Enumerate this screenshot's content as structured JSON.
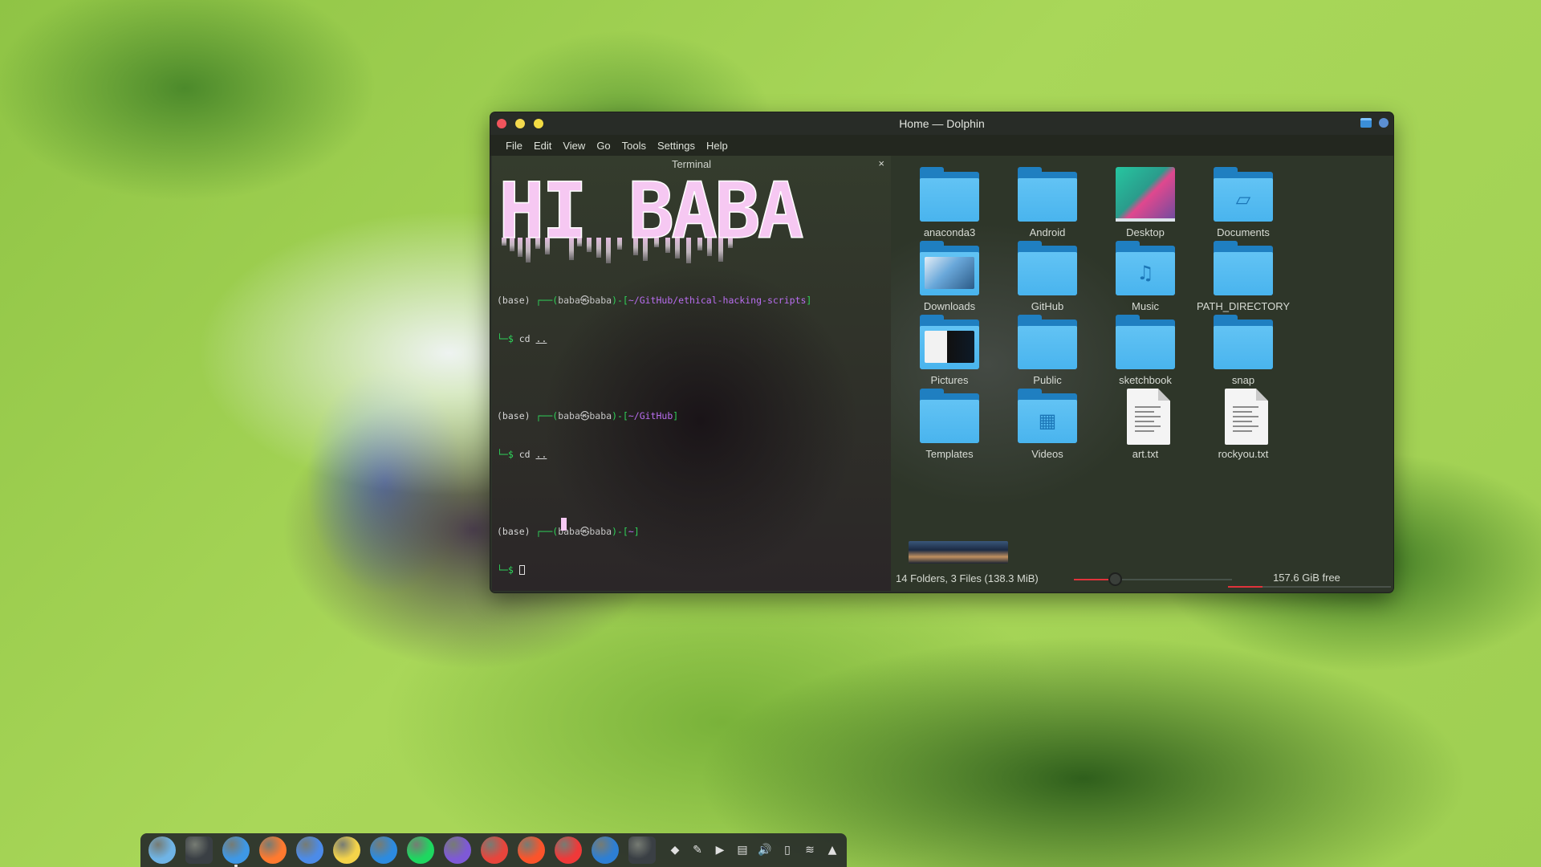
{
  "window": {
    "title": "Home — Dolphin",
    "menu": [
      "File",
      "Edit",
      "View",
      "Go",
      "Tools",
      "Settings",
      "Help"
    ]
  },
  "terminal": {
    "title": "Terminal",
    "close_glyph": "×",
    "banner": "HI BABA",
    "lines": [
      {
        "env": "(base)",
        "prefix": "┌──(",
        "user": "baba㉿baba",
        "mid": ")-[",
        "path": "~/GitHub/ethical-hacking-scripts",
        "end": "]",
        "cmd_prefix": "└─$",
        "cmd": "cd",
        "arg": ".."
      },
      {
        "env": "(base)",
        "prefix": "┌──(",
        "user": "baba㉿baba",
        "mid": ")-[",
        "path": "~/GitHub",
        "end": "]",
        "cmd_prefix": "└─$",
        "cmd": "cd",
        "arg": ".."
      },
      {
        "env": "(base)",
        "prefix": "┌──(",
        "user": "baba㉿baba",
        "mid": ")-[",
        "path": "~",
        "end": "]",
        "cmd_prefix": "└─$",
        "cmd": "",
        "arg": ""
      }
    ]
  },
  "files": {
    "items": [
      {
        "name": "anaconda3",
        "kind": "folder",
        "icon": "folder-icon"
      },
      {
        "name": "Android",
        "kind": "folder",
        "icon": "folder-icon"
      },
      {
        "name": "Desktop",
        "kind": "desktop",
        "icon": "desktop-thumbnail"
      },
      {
        "name": "Documents",
        "kind": "folder",
        "icon": "folder-documents-icon",
        "glyph": "▱"
      },
      {
        "name": "Downloads",
        "kind": "thumb-dl",
        "icon": "downloads-thumbnail"
      },
      {
        "name": "GitHub",
        "kind": "folder",
        "icon": "folder-icon"
      },
      {
        "name": "Music",
        "kind": "folder",
        "icon": "folder-music-icon",
        "glyph": "♫"
      },
      {
        "name": "PATH_DIRECTORY",
        "kind": "folder",
        "icon": "folder-icon"
      },
      {
        "name": "Pictures",
        "kind": "thumb-pic",
        "icon": "pictures-thumbnail"
      },
      {
        "name": "Public",
        "kind": "folder",
        "icon": "folder-icon"
      },
      {
        "name": "sketchbook",
        "kind": "folder",
        "icon": "folder-icon"
      },
      {
        "name": "snap",
        "kind": "folder",
        "icon": "folder-icon"
      },
      {
        "name": "Templates",
        "kind": "folder",
        "icon": "folder-icon"
      },
      {
        "name": "Videos",
        "kind": "folder",
        "icon": "folder-videos-icon",
        "glyph": "▦"
      },
      {
        "name": "art.txt",
        "kind": "doc",
        "icon": "text-file-icon"
      },
      {
        "name": "rockyou.txt",
        "kind": "doc",
        "icon": "text-file-icon"
      }
    ],
    "status": "14 Folders, 3 Files (138.3 MiB)",
    "zoom_fraction": 0.26,
    "free_space": "157.6 GiB free",
    "used_fraction": 0.21
  },
  "dock": {
    "apps": [
      {
        "name": "elementary-launcher",
        "color": "#6fb4e6",
        "active": false
      },
      {
        "name": "terminal",
        "color": "#3a3f44",
        "active": false
      },
      {
        "name": "files",
        "color": "#3e98e6",
        "active": true
      },
      {
        "name": "firefox",
        "color": "#ff7a2f",
        "active": false
      },
      {
        "name": "chromium",
        "color": "#4c8be8",
        "active": false
      },
      {
        "name": "notes",
        "color": "#f4d34a",
        "active": false
      },
      {
        "name": "vscode",
        "color": "#2c8be0",
        "active": false
      },
      {
        "name": "spotify",
        "color": "#1ed760",
        "active": false
      },
      {
        "name": "obsidian",
        "color": "#7e59d6",
        "active": false
      },
      {
        "name": "chrome",
        "color": "#e8453c",
        "active": false
      },
      {
        "name": "brave",
        "color": "#fb542b",
        "active": false
      },
      {
        "name": "vivaldi",
        "color": "#ef3939",
        "active": false
      },
      {
        "name": "bolt",
        "color": "#2d7fd4",
        "active": false
      },
      {
        "name": "activity",
        "color": "#3a3f44",
        "active": false
      }
    ],
    "tray": [
      {
        "name": "anydesk-icon",
        "glyph": "◆"
      },
      {
        "name": "pen-icon",
        "glyph": "✎"
      },
      {
        "name": "media-play-icon",
        "glyph": "▶"
      },
      {
        "name": "clipboard-icon",
        "glyph": "▤"
      },
      {
        "name": "volume-icon",
        "glyph": "🔊"
      },
      {
        "name": "battery-icon",
        "glyph": "▯"
      },
      {
        "name": "wifi-icon",
        "glyph": "≋"
      },
      {
        "name": "tray-expand-icon",
        "glyph": "▲"
      }
    ]
  }
}
